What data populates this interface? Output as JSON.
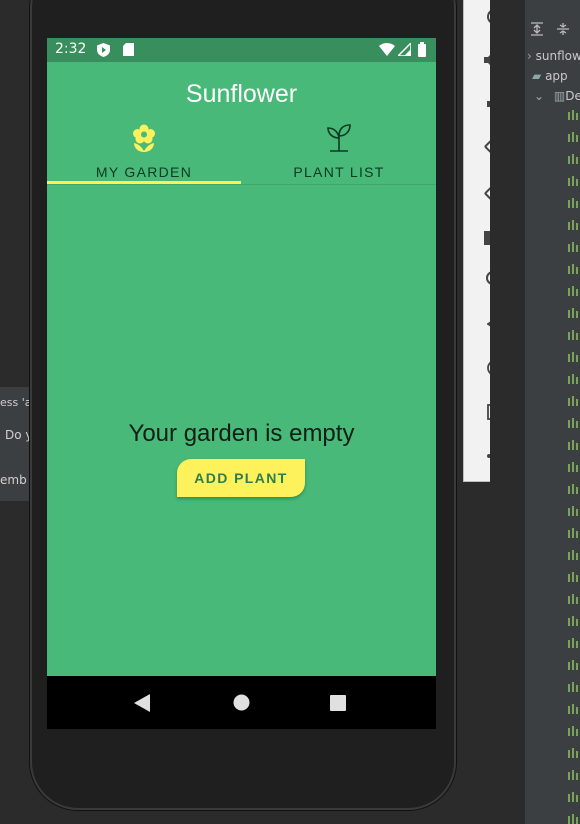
{
  "ide": {
    "dialog_line1": "ess 'ap",
    "dialog_line2": "Do y",
    "dialog_line3": "emb"
  },
  "project": {
    "root_label": "sunflowe",
    "app_label": "app",
    "folder_label": "De"
  },
  "status_bar": {
    "time": "2:32"
  },
  "app": {
    "title": "Sunflower",
    "tabs": [
      {
        "label": "MY GARDEN",
        "icon": "flower-icon",
        "selected": true
      },
      {
        "label": "PLANT LIST",
        "icon": "sprout-icon",
        "selected": false
      }
    ],
    "empty_message": "Your garden is empty",
    "add_button": "ADD PLANT"
  },
  "colors": {
    "primary": "#48b978",
    "primary_dark": "#388e5c",
    "accent": "#fdf25c"
  },
  "emulator_toolbar": [
    "power-icon",
    "volume-up-icon",
    "volume-down-icon",
    "rotate-left-icon",
    "rotate-right-icon",
    "camera-icon",
    "zoom-icon",
    "back-icon",
    "home-icon",
    "overview-icon",
    "more-icon"
  ]
}
